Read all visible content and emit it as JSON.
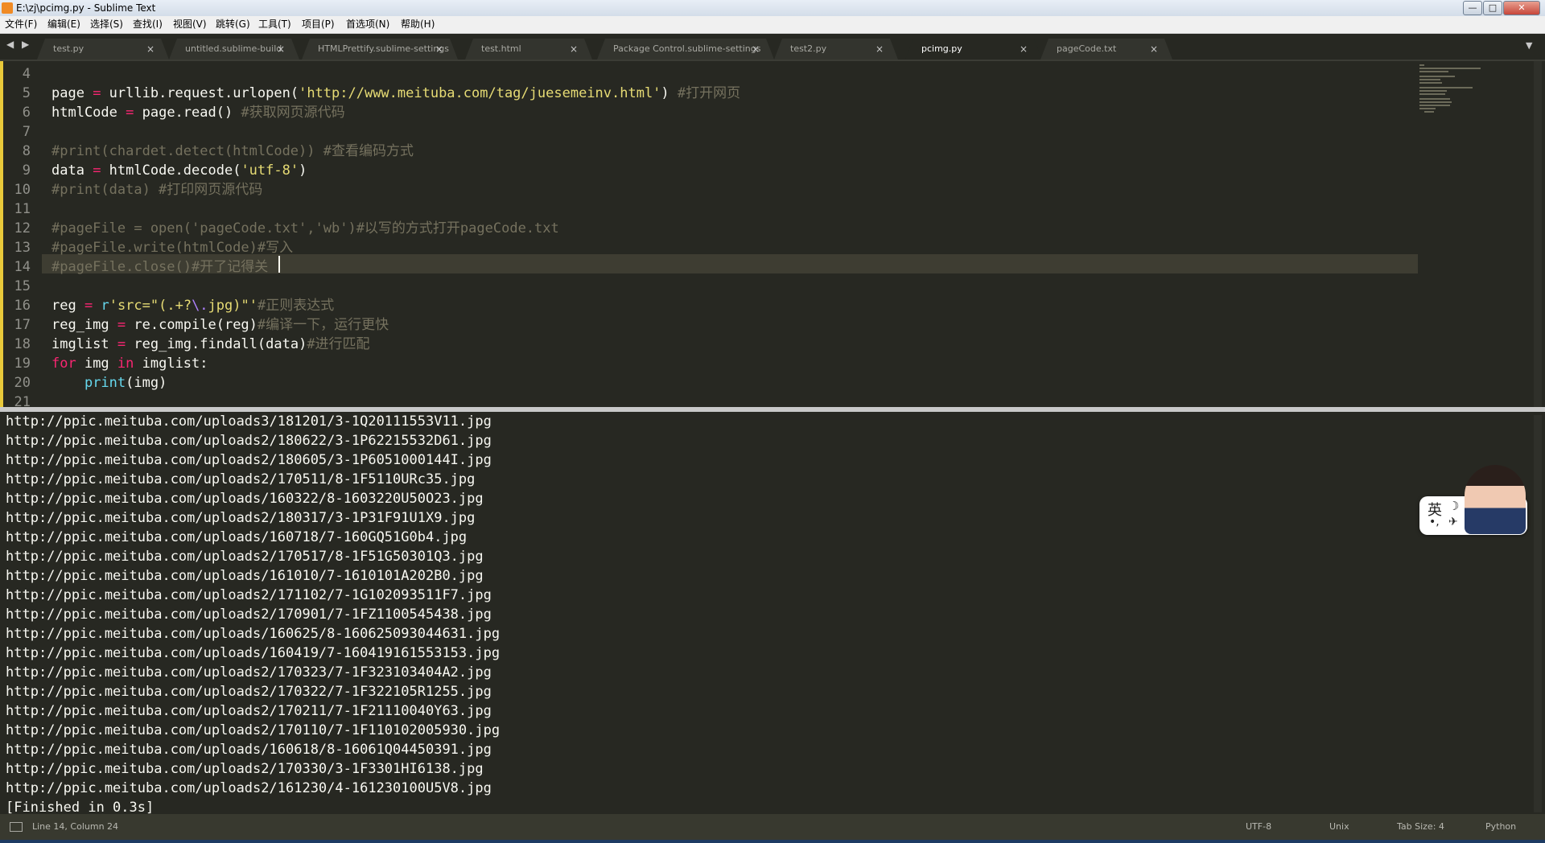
{
  "window": {
    "title": "E:\\zj\\pcimg.py - Sublime Text",
    "min_glyph": "—",
    "max_glyph": "□",
    "close_glyph": "✕"
  },
  "menu": [
    "文件(F)",
    "编辑(E)",
    "选择(S)",
    "查找(I)",
    "视图(V)",
    "跳转(G)",
    "工具(T)",
    "项目(P)",
    "首选项(N)",
    "帮助(H)"
  ],
  "tabs": {
    "scroll_glyph": "◀ ▶",
    "dropdown_glyph": "▼",
    "close_glyph": "×",
    "items": [
      {
        "label": "test.py",
        "active": false
      },
      {
        "label": "untitled.sublime-build",
        "active": false
      },
      {
        "label": "HTMLPrettify.sublime-settings",
        "active": false
      },
      {
        "label": "test.html",
        "active": false
      },
      {
        "label": "Package Control.sublime-settings",
        "active": false
      },
      {
        "label": "test2.py",
        "active": false
      },
      {
        "label": "pcimg.py",
        "active": true
      },
      {
        "label": "pageCode.txt",
        "active": false
      }
    ]
  },
  "editor": {
    "first_line_number": 4,
    "current_line": 14,
    "lines": [
      [],
      [
        [
          "page ",
          ""
        ],
        [
          "=",
          "kw"
        ],
        [
          " urllib.request.urlopen(",
          ""
        ],
        [
          "'http://www.meituba.com/tag/juesemeinv.html'",
          "str"
        ],
        [
          ") ",
          ""
        ],
        [
          "#打开网页",
          "cm"
        ]
      ],
      [
        [
          "htmlCode ",
          ""
        ],
        [
          "=",
          "kw"
        ],
        [
          " page.read() ",
          ""
        ],
        [
          "#获取网页源代码",
          "cm"
        ]
      ],
      [],
      [
        [
          "#print(chardet.detect(htmlCode)) #查看编码方式",
          "cm"
        ]
      ],
      [
        [
          "data ",
          ""
        ],
        [
          "=",
          "kw"
        ],
        [
          " htmlCode.decode(",
          ""
        ],
        [
          "'utf-8'",
          "str"
        ],
        [
          ")",
          ""
        ]
      ],
      [
        [
          "#print(data) #打印网页源代码",
          "cm"
        ]
      ],
      [],
      [
        [
          "#pageFile = open('pageCode.txt','wb')#以写的方式打开pageCode.txt",
          "cm"
        ]
      ],
      [
        [
          "#pageFile.write(htmlCode)#写入",
          "cm"
        ]
      ],
      [
        [
          "#pageFile.close()#开了记得关",
          "cm"
        ]
      ],
      [],
      [
        [
          "reg ",
          ""
        ],
        [
          "=",
          "kw"
        ],
        [
          " ",
          ""
        ],
        [
          "r",
          "bi"
        ],
        [
          "'src=\"(.+?",
          "str"
        ],
        [
          "\\.",
          "sp"
        ],
        [
          "jpg)\"'",
          "str"
        ],
        [
          "#正则表达式",
          "cm"
        ]
      ],
      [
        [
          "reg_img ",
          ""
        ],
        [
          "=",
          "kw"
        ],
        [
          " re.compile(reg)",
          ""
        ],
        [
          "#编译一下，运行更快",
          "cm"
        ]
      ],
      [
        [
          "imglist ",
          ""
        ],
        [
          "=",
          "kw"
        ],
        [
          " reg_img.findall(data)",
          ""
        ],
        [
          "#进行匹配",
          "cm"
        ]
      ],
      [
        [
          "for",
          "kw"
        ],
        [
          " img ",
          ""
        ],
        [
          "in",
          "kw"
        ],
        [
          " imglist:",
          ""
        ]
      ],
      [
        [
          "    ",
          ""
        ],
        [
          "print",
          "bi"
        ],
        [
          "(img)",
          ""
        ]
      ],
      []
    ]
  },
  "output": {
    "lines": [
      "http://ppic.meituba.com/uploads3/181201/3-1Q20111553V11.jpg",
      "http://ppic.meituba.com/uploads2/180622/3-1P62215532D61.jpg",
      "http://ppic.meituba.com/uploads2/180605/3-1P6051000144I.jpg",
      "http://ppic.meituba.com/uploads2/170511/8-1F5110URc35.jpg",
      "http://ppic.meituba.com/uploads/160322/8-1603220U50O23.jpg",
      "http://ppic.meituba.com/uploads2/180317/3-1P31F91U1X9.jpg",
      "http://ppic.meituba.com/uploads/160718/7-160GQ51G0b4.jpg",
      "http://ppic.meituba.com/uploads2/170517/8-1F51G50301Q3.jpg",
      "http://ppic.meituba.com/uploads/161010/7-1610101A202B0.jpg",
      "http://ppic.meituba.com/uploads2/171102/7-1G102093511F7.jpg",
      "http://ppic.meituba.com/uploads2/170901/7-1FZ1100545438.jpg",
      "http://ppic.meituba.com/uploads/160625/8-160625093044631.jpg",
      "http://ppic.meituba.com/uploads/160419/7-160419161553153.jpg",
      "http://ppic.meituba.com/uploads2/170323/7-1F323103404A2.jpg",
      "http://ppic.meituba.com/uploads2/170322/7-1F322105R1255.jpg",
      "http://ppic.meituba.com/uploads2/170211/7-1F21110040Y63.jpg",
      "http://ppic.meituba.com/uploads2/170110/7-1F110102005930.jpg",
      "http://ppic.meituba.com/uploads/160618/8-16061Q04450391.jpg",
      "http://ppic.meituba.com/uploads2/170330/3-1F3301HI6138.jpg",
      "http://ppic.meituba.com/uploads2/161230/4-161230100U5V8.jpg",
      "[Finished in 0.3s]"
    ]
  },
  "status": {
    "position": "Line 14, Column 24",
    "encoding": "UTF-8",
    "line_endings": "Unix",
    "tab_size": "Tab Size: 4",
    "syntax": "Python"
  },
  "ime": {
    "mode_char": "英",
    "moon_glyph": "☽",
    "punct_glyph": "•,",
    "fly_glyph": "✈"
  },
  "colors": {
    "editor_bg": "#272822",
    "keyword": "#f92672",
    "string": "#e6db74",
    "comment": "#75715e",
    "builtin": "#66d9ef"
  }
}
